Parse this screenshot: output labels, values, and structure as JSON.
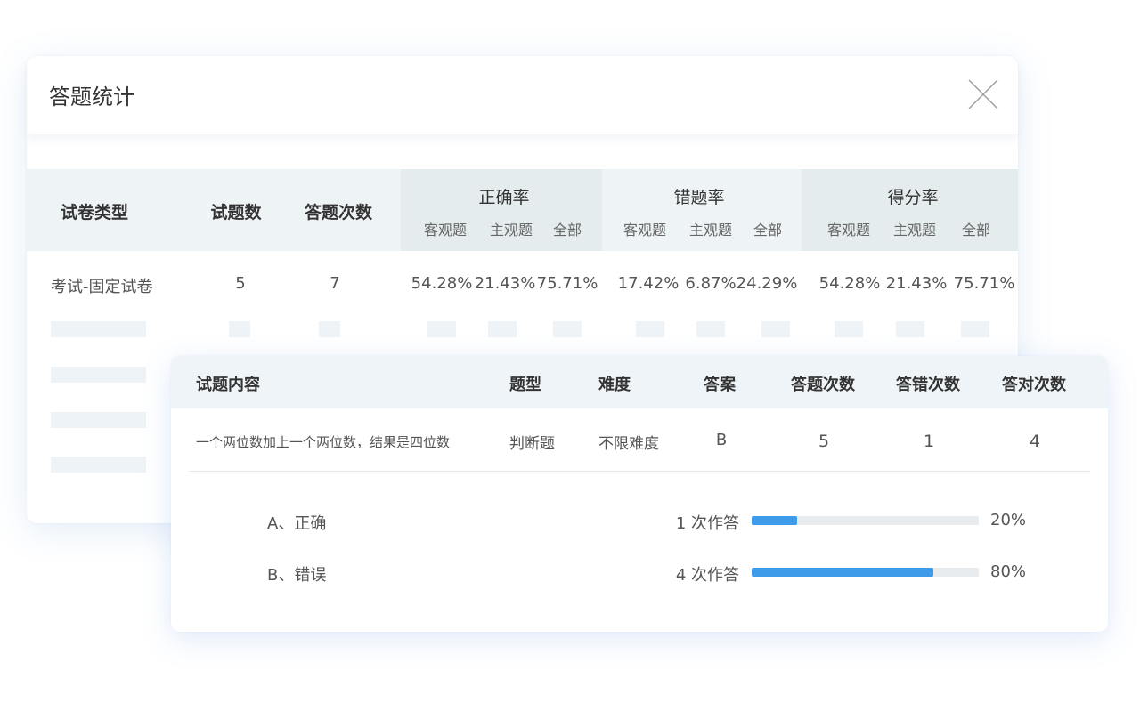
{
  "modal": {
    "title": "答题统计",
    "close_icon": "close-icon"
  },
  "stats_table": {
    "headers": {
      "paper_type": "试卷类型",
      "question_count": "试题数",
      "answer_times": "答题次数",
      "groups": [
        {
          "label": "正确率",
          "subs": [
            "客观题",
            "主观题",
            "全部"
          ]
        },
        {
          "label": "错题率",
          "subs": [
            "客观题",
            "主观题",
            "全部"
          ]
        },
        {
          "label": "得分率",
          "subs": [
            "客观题",
            "主观题",
            "全部"
          ]
        }
      ]
    },
    "row": {
      "paper_type": "考试-固定试卷",
      "question_count": "5",
      "answer_times": "7",
      "values": [
        "54.28%",
        "21.43%",
        "75.71%",
        "17.42%",
        "6.87%",
        "24.29%",
        "54.28%",
        "21.43%",
        "75.71%"
      ]
    }
  },
  "question_panel": {
    "headers": [
      "试题内容",
      "题型",
      "难度",
      "答案",
      "答题次数",
      "答错次数",
      "答对次数"
    ],
    "row": {
      "content": "一个两位数加上一个两位数，结果是四位数",
      "type": "判断题",
      "difficulty": "不限难度",
      "answer": "B",
      "answer_times": "5",
      "wrong_times": "1",
      "right_times": "4"
    },
    "options": [
      {
        "label": "A、正确",
        "count_text": "1 次作答",
        "percent_text": "20%",
        "fraction": 0.2
      },
      {
        "label": "B、错误",
        "count_text": "4 次作答",
        "percent_text": "80%",
        "fraction": 0.8
      }
    ],
    "bar_color": "#3d9be9"
  }
}
